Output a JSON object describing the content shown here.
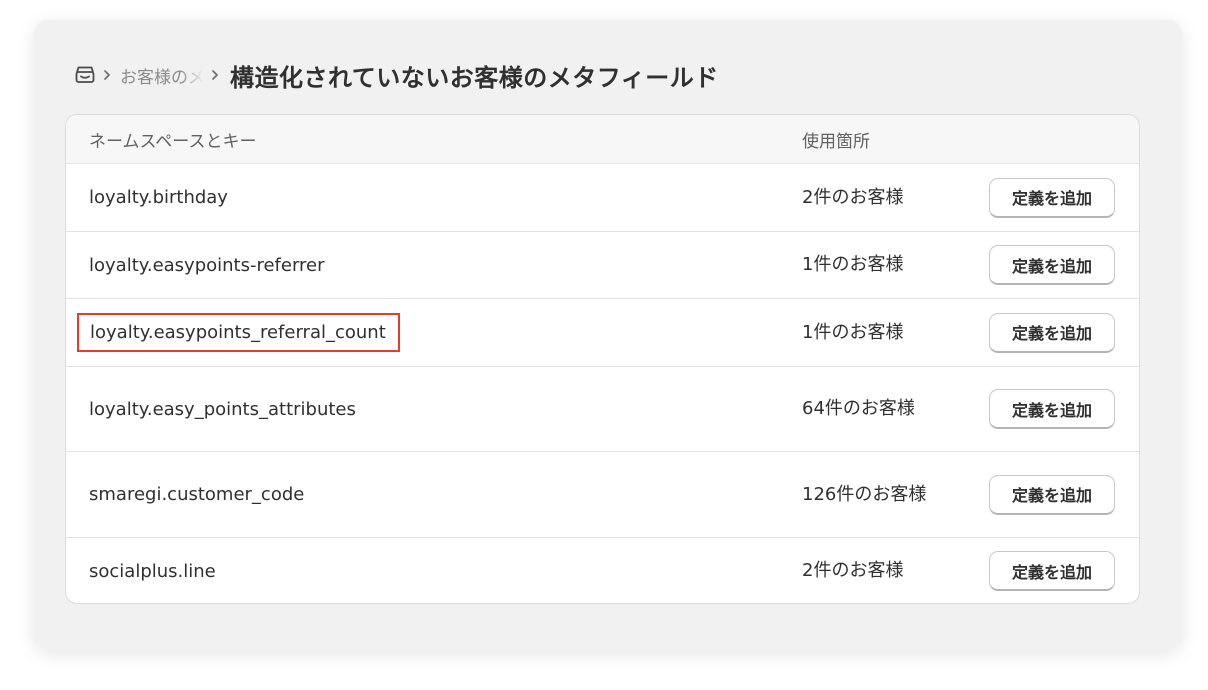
{
  "breadcrumb": {
    "parent_label": "お客様のメタフィールド",
    "title": "構造化されていないお客様のメタフィールド"
  },
  "table": {
    "headers": {
      "key": "ネームスペースとキー",
      "usage": "使用箇所"
    },
    "action_label": "定義を追加",
    "rows": [
      {
        "key": "loyalty.birthday",
        "usage": "2件のお客様"
      },
      {
        "key": "loyalty.easypoints-referrer",
        "usage": "1件のお客様"
      },
      {
        "key": "loyalty.easypoints_referral_count",
        "usage": "1件のお客様",
        "highlighted": true
      },
      {
        "key": "loyalty.easy_points_attributes",
        "usage": "64件のお客様"
      },
      {
        "key": "smaregi.customer_code",
        "usage": "126件のお客様"
      },
      {
        "key": "socialplus.line",
        "usage": "2件のお客様"
      }
    ]
  },
  "colors": {
    "highlight_border": "#e0402a",
    "panel_background": "#f1f1f1"
  },
  "icons": {
    "store": "store-icon",
    "separator": "chevron-right-icon"
  }
}
